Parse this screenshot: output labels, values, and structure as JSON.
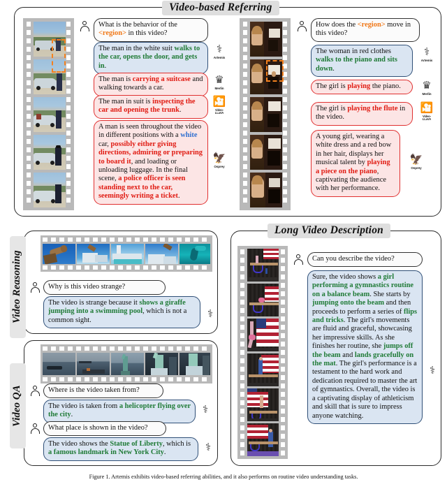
{
  "figure": {
    "caption": "Figure 1. Artemis exhibits video-based referring abilities, and it also performs on routine video understanding tasks."
  },
  "panels": {
    "video_based_referring": {
      "title": "Video-based Referring",
      "left": {
        "filmstrip_name": "car-scene-filmstrip",
        "question": {
          "pre": "What is the behavior of the ",
          "tag": "<region>",
          "post": " in this video?"
        },
        "answers": [
          {
            "model": "Artemis",
            "style": "blue",
            "parts": [
              {
                "t": "The man in the white suit ",
                "c": "plain"
              },
              {
                "t": "walks to the car, opens the door, and gets in",
                "c": "green"
              },
              {
                "t": ".",
                "c": "plain"
              }
            ]
          },
          {
            "model": "Merlin",
            "style": "pink",
            "parts": [
              {
                "t": "The man is ",
                "c": "plain"
              },
              {
                "t": "carrying a suitcase",
                "c": "red"
              },
              {
                "t": " and walking towards a car.",
                "c": "plain"
              }
            ]
          },
          {
            "model": "Video-LLaVA",
            "style": "pink",
            "parts": [
              {
                "t": "The man in suit is ",
                "c": "plain"
              },
              {
                "t": "inspecting the car and opening the trunk",
                "c": "red"
              },
              {
                "t": ".",
                "c": "plain"
              }
            ]
          },
          {
            "model": "Osprey",
            "style": "pink",
            "parts": [
              {
                "t": "A man is seen throughout the video in different positions with a ",
                "c": "plain"
              },
              {
                "t": "white",
                "c": "blue"
              },
              {
                "t": " car, ",
                "c": "plain"
              },
              {
                "t": "possibly either giving directions, admiring or preparing to board it",
                "c": "red"
              },
              {
                "t": ", and loading or unloading luggage. In the final scene, ",
                "c": "plain"
              },
              {
                "t": "a police officer is seen standing next to the car, seemingly writing a ticket",
                "c": "red"
              },
              {
                "t": ".",
                "c": "plain"
              }
            ]
          }
        ]
      },
      "right": {
        "filmstrip_name": "piano-scene-filmstrip",
        "question": {
          "pre": "How does the ",
          "tag": "<region>",
          "post": " move in this video?"
        },
        "answers": [
          {
            "model": "Artemis",
            "style": "blue",
            "parts": [
              {
                "t": "The woman in red clothes ",
                "c": "plain"
              },
              {
                "t": "walks to the piano and sits down",
                "c": "green"
              },
              {
                "t": ".",
                "c": "plain"
              }
            ]
          },
          {
            "model": "Merlin",
            "style": "pink",
            "parts": [
              {
                "t": "The girl is ",
                "c": "plain"
              },
              {
                "t": "playing",
                "c": "red"
              },
              {
                "t": " the piano.",
                "c": "plain"
              }
            ]
          },
          {
            "model": "Video-LLaVA",
            "style": "pink",
            "parts": [
              {
                "t": "The girl is ",
                "c": "plain"
              },
              {
                "t": "playing the flute",
                "c": "red"
              },
              {
                "t": " in the video.",
                "c": "plain"
              }
            ]
          },
          {
            "model": "Osprey",
            "style": "pink",
            "parts": [
              {
                "t": "A young girl, wearing a white dress and a red bow in her hair, displays her musical talent by ",
                "c": "plain"
              },
              {
                "t": "playing a piece on the piano",
                "c": "red"
              },
              {
                "t": ", captivating the audience with her performance.",
                "c": "plain"
              }
            ]
          }
        ]
      }
    },
    "video_reasoning": {
      "side_label": "Video Reasoning",
      "filmstrip_name": "giraffe-pool-filmstrip",
      "question": "Why is this video strange?",
      "answer": {
        "model": "Artemis",
        "style": "blue",
        "parts": [
          {
            "t": "The video is strange because it ",
            "c": "plain"
          },
          {
            "t": "shows a giraffe jumping into a swimming pool",
            "c": "green"
          },
          {
            "t": ", which is not a common sight.",
            "c": "plain"
          }
        ]
      }
    },
    "video_qa": {
      "side_label": "Video QA",
      "filmstrip_name": "statue-of-liberty-filmstrip",
      "turns": [
        {
          "question": "Where is the video taken from?",
          "answer": {
            "model": "Artemis",
            "style": "blue",
            "parts": [
              {
                "t": "The video is taken from ",
                "c": "plain"
              },
              {
                "t": "a helicopter flying over the city",
                "c": "green"
              },
              {
                "t": ".",
                "c": "plain"
              }
            ]
          }
        },
        {
          "question": "What place is shown in the video?",
          "answer": {
            "model": "Artemis",
            "style": "blue",
            "parts": [
              {
                "t": "The video shows the ",
                "c": "plain"
              },
              {
                "t": "Statue of Liberty",
                "c": "green"
              },
              {
                "t": ", which is ",
                "c": "plain"
              },
              {
                "t": "a famous landmark in New York City",
                "c": "green"
              },
              {
                "t": ".",
                "c": "plain"
              }
            ]
          }
        }
      ]
    },
    "long_video_description": {
      "title": "Long Video Description",
      "filmstrip_name": "gymnastics-balance-beam-filmstrip",
      "question": "Can you describe the video?",
      "answer": {
        "model": "Artemis",
        "style": "blue",
        "parts": [
          {
            "t": "Sure, the video shows ",
            "c": "plain"
          },
          {
            "t": "a girl performing a gymnastics routine on a balance beam",
            "c": "green"
          },
          {
            "t": ". She starts by ",
            "c": "plain"
          },
          {
            "t": "jumping onto the beam",
            "c": "green"
          },
          {
            "t": " and then proceeds to perform a series of ",
            "c": "plain"
          },
          {
            "t": "flips and tricks",
            "c": "green"
          },
          {
            "t": ". The girl's movements are fluid and graceful, showcasing her impressive skills. As she finishes her routine, she ",
            "c": "plain"
          },
          {
            "t": "jumps off the beam",
            "c": "green"
          },
          {
            "t": " and ",
            "c": "plain"
          },
          {
            "t": "lands gracefully on the mat",
            "c": "green"
          },
          {
            "t": ". The girl's performance is a testament to the hard work and dedication required to master the art of gymnastics. Overall, the video is a captivating display of athleticism and skill that is sure to impress anyone watching.",
            "c": "plain"
          }
        ]
      }
    }
  },
  "colors": {
    "green": "#1f7a36",
    "red": "#e01b12",
    "orange": "#f07818",
    "blue": "#2f6fd0",
    "bubble_blue_bg": "#dae5f2",
    "bubble_pink_bg": "#fce5e5",
    "highlight_box": "#f4811f"
  },
  "icons": {
    "person": "person-icon",
    "artemis": "artemis-avatar-icon",
    "merlin": "merlin-avatar-icon",
    "video_llava": "video-llava-avatar-icon",
    "osprey": "osprey-avatar-icon"
  }
}
